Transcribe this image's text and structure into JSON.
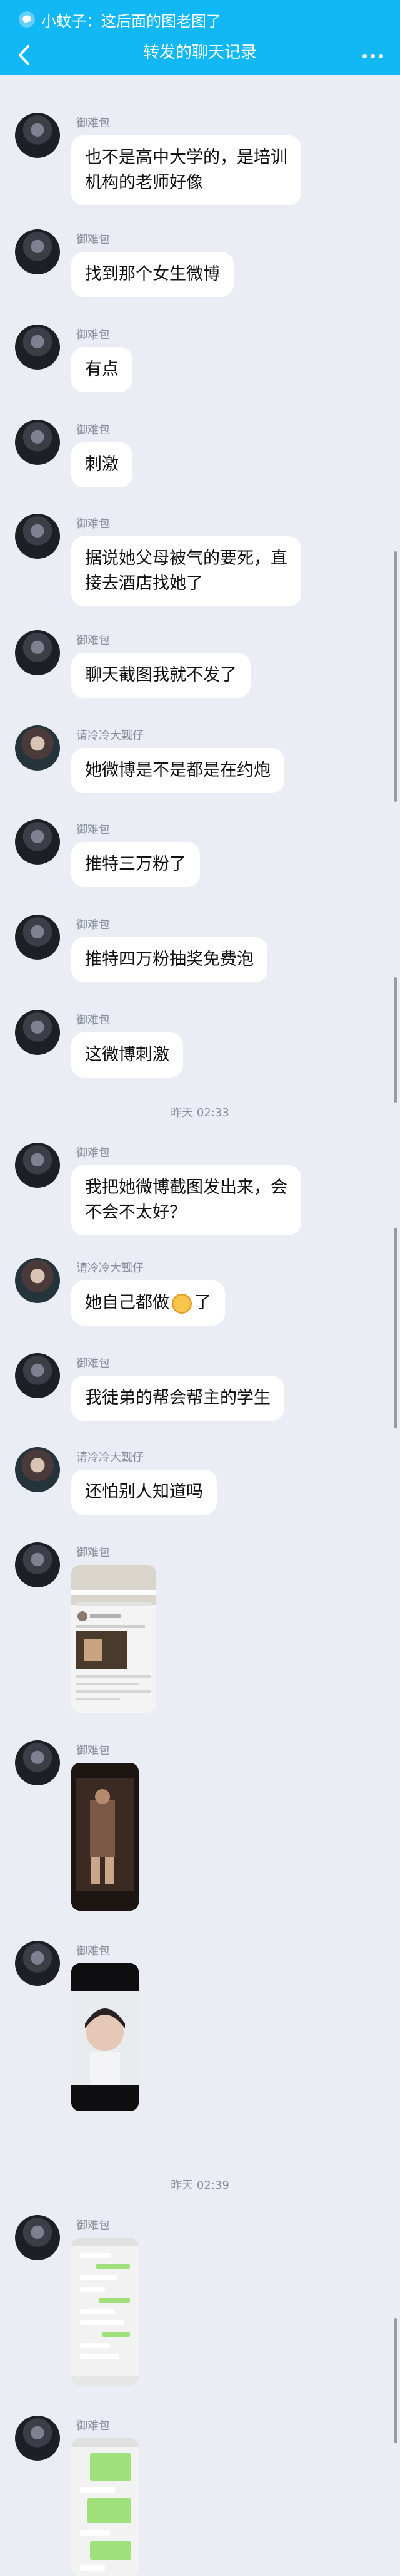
{
  "header": {
    "notification_text": "小蚊子：这后面的图老图了",
    "title": "转发的聊天记录",
    "colors": {
      "bar": "#12b7f5",
      "text": "#ffffff"
    }
  },
  "senders": {
    "a": "御难包",
    "b": "请冷冷大觐仔"
  },
  "messages": [
    {
      "sender": "御难包",
      "text": "也不是高中大学的，是培训\n机构的老师好像"
    },
    {
      "sender": "御难包",
      "text": "找到那个女生微博"
    },
    {
      "sender": "御难包",
      "text": "有点"
    },
    {
      "sender": "御难包",
      "text": "刺激"
    },
    {
      "sender": "御难包",
      "text": "据说她父母被气的要死，直\n接去酒店找她了"
    },
    {
      "sender": "御难包",
      "text": "聊天截图我就不发了"
    },
    {
      "sender": "请冷冷大觐仔",
      "text": "她微博是不是都是在约炮"
    },
    {
      "sender": "御难包",
      "text": "推特三万粉了"
    },
    {
      "sender": "御难包",
      "text": "推特四万粉抽奖免费泡"
    },
    {
      "sender": "御难包",
      "text": "这微博刺激"
    },
    {
      "sender": "御难包",
      "text": "我把她微博截图发出来，会\n不会不太好？"
    },
    {
      "sender": "请冷冷大觐仔",
      "text_before": "她自己都做",
      "text_after": "了"
    },
    {
      "sender": "御难包",
      "text": "我徒弟的帮会帮主的学生"
    },
    {
      "sender": "请冷冷大觐仔",
      "text": "还怕别人知道吗"
    }
  ],
  "timestamps": [
    "昨天 02:33",
    "昨天 02:39"
  ],
  "images": [
    {
      "sender": "御难包",
      "kind": "screenshot-weibo-profile"
    },
    {
      "sender": "御难包",
      "kind": "photo-mirror-selfie"
    },
    {
      "sender": "御难包",
      "kind": "photo-portrait"
    },
    {
      "sender": "御难包",
      "kind": "screenshot-chat-white"
    },
    {
      "sender": "御难包",
      "kind": "screenshot-chat-green"
    }
  ],
  "icons": {
    "notify": "chat-bubble-icon",
    "back": "chevron-left-icon",
    "more": "ellipsis-icon",
    "emoji": "wink-emoji-icon"
  }
}
